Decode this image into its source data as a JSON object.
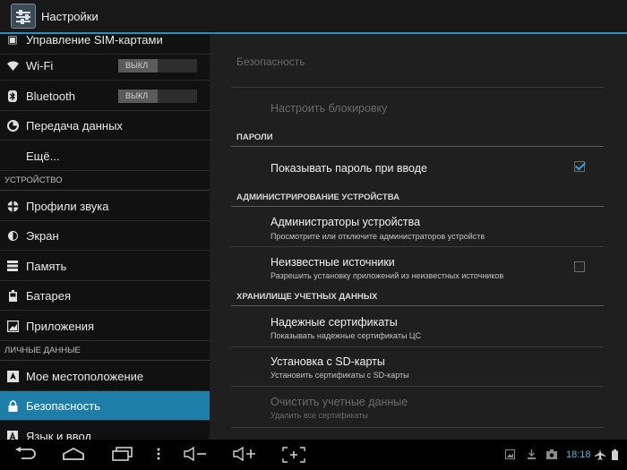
{
  "actionbar": {
    "title": "Настройки",
    "icon": "settings-sliders-icon"
  },
  "left": {
    "items": [
      {
        "label": "Управление SIM-картами",
        "icon": "sim-icon"
      },
      {
        "label": "Wi-Fi",
        "icon": "wifi-icon",
        "switch": "ВЫКЛ"
      },
      {
        "label": "Bluetooth",
        "icon": "bluetooth-icon",
        "switch": "ВЫКЛ"
      },
      {
        "label": "Передача данных",
        "icon": "data-usage-icon"
      },
      {
        "label": "Ещё...",
        "icon": ""
      },
      {
        "label": "Профили звука",
        "icon": "sound-icon"
      },
      {
        "label": "Экран",
        "icon": "display-icon"
      },
      {
        "label": "Память",
        "icon": "storage-icon"
      },
      {
        "label": "Батарея",
        "icon": "battery-icon"
      },
      {
        "label": "Приложения",
        "icon": "apps-icon"
      },
      {
        "label": "Мое местоположение",
        "icon": "location-icon"
      },
      {
        "label": "Безопасность",
        "icon": "lock-icon",
        "selected": true
      },
      {
        "label": "Язык и ввод",
        "icon": "language-icon"
      }
    ],
    "sections": [
      "УСТРОЙСТВО",
      "ЛИЧНЫЕ ДАННЫЕ"
    ]
  },
  "right": {
    "header": "Безопасность",
    "lock_setup": "Настроить блокировку",
    "sections": {
      "passwords": "ПАРОЛИ",
      "device_admin": "АДМИНИСТРИРОВАНИЕ УСТРОЙСТВА",
      "credential_storage": "ХРАНИЛИЩЕ УЧЕТНЫХ ДАННЫХ"
    },
    "show_password": {
      "title": "Показывать пароль при вводе",
      "checked": true
    },
    "device_admins": {
      "title": "Администраторы устройства",
      "sub": "Просмотрите или отключите администраторов устройств"
    },
    "unknown_sources": {
      "title": "Неизвестные источники",
      "sub": "Разрешить установку приложений из неизвестных источников",
      "checked": false
    },
    "trusted_certs": {
      "title": "Надежные сертификаты",
      "sub": "Показывать надежные сертификаты ЦС"
    },
    "install_sd": {
      "title": "Установка с SD-карты",
      "sub": "Установить сертификаты с SD-карты"
    },
    "clear_creds": {
      "title": "Очистить учетные данные",
      "sub": "Удалить все сертификаты"
    }
  },
  "statusbar": {
    "time": "18:18"
  },
  "colors": {
    "accent": "#2c8fc0",
    "selected": "#1c7ea9",
    "check": "#2ba3df"
  }
}
